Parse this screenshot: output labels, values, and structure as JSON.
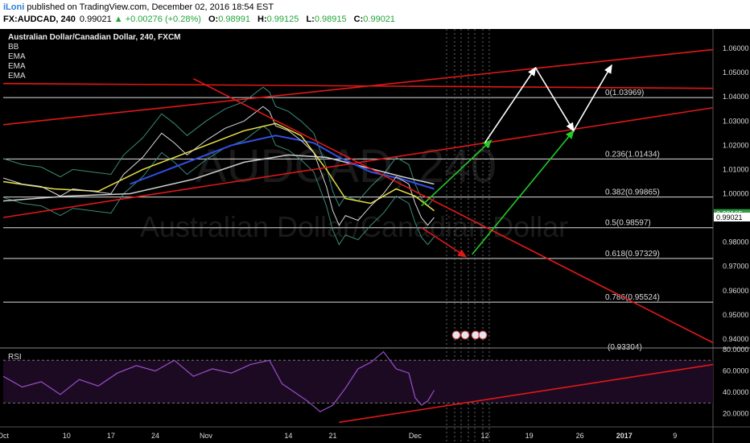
{
  "header": {
    "author": "iLoni",
    "published": "published on TradingView.com, December 02, 2016 18:54 EST",
    "symbol": "FX:AUDCAD, 240",
    "price": "0.99021",
    "change": "+0.00276 (+0.28%)",
    "o_label": "O:",
    "o": "0.98991",
    "h_label": "H:",
    "h": "0.99125",
    "l_label": "L:",
    "l": "0.98915",
    "c_label": "C:",
    "c": "0.99021"
  },
  "indicators": [
    "BB",
    "EMA",
    "EMA",
    "EMA"
  ],
  "colors": {
    "background": "#000000",
    "trendline": "#e01818",
    "fib": "#dddddd",
    "arrow_up": "#22cc22",
    "arrow_white": "#ffffff",
    "ema_yellow": "#e8e040",
    "ema_blue": "#3050e8",
    "ema_white": "#cccccc",
    "rsi_line": "#9a4fc8"
  },
  "chart_data": {
    "type": "line",
    "title": "Australian Dollar/Canadian Dollar, 240, FXCM",
    "watermark_symbol": "AUDCAD, 240",
    "watermark_name": "Australian Dollar/Canadian Dollar",
    "ylim": [
      0.937,
      1.068
    ],
    "yticks": [
      1.06,
      1.05,
      1.04,
      1.03,
      1.02,
      1.01,
      1.0,
      0.99,
      0.98,
      0.97,
      0.96,
      0.95,
      0.94
    ],
    "ytick_labels": [
      "1.06000",
      "1.05000",
      "1.04000",
      "1.03000",
      "1.02000",
      "1.01000",
      "1.00000",
      "0.99000",
      "0.98000",
      "0.97000",
      "0.96000",
      "0.95000",
      "0.94000"
    ],
    "xticks": [
      {
        "t": 0,
        "label": "Oct"
      },
      {
        "t": 10,
        "label": "10"
      },
      {
        "t": 17,
        "label": "17"
      },
      {
        "t": 24,
        "label": "24"
      },
      {
        "t": 32,
        "label": "Nov"
      },
      {
        "t": 45,
        "label": "14"
      },
      {
        "t": 52,
        "label": "21"
      },
      {
        "t": 65,
        "label": "Dec"
      },
      {
        "t": 76,
        "label": "12"
      },
      {
        "t": 83,
        "label": "19"
      },
      {
        "t": 91,
        "label": "26"
      },
      {
        "t": 98,
        "label": "2017"
      },
      {
        "t": 106,
        "label": "9"
      }
    ],
    "price_series": [
      {
        "t": 0,
        "y": 1.0065
      },
      {
        "t": 3,
        "y": 1.004
      },
      {
        "t": 6,
        "y": 1.003
      },
      {
        "t": 9,
        "y": 0.999
      },
      {
        "t": 11,
        "y": 1.002
      },
      {
        "t": 14,
        "y": 1.001
      },
      {
        "t": 17,
        "y": 1.0
      },
      {
        "t": 19,
        "y": 1.008
      },
      {
        "t": 22,
        "y": 1.015
      },
      {
        "t": 25,
        "y": 1.025
      },
      {
        "t": 27,
        "y": 1.021
      },
      {
        "t": 29,
        "y": 1.016
      },
      {
        "t": 32,
        "y": 1.022
      },
      {
        "t": 35,
        "y": 1.027
      },
      {
        "t": 38,
        "y": 1.03
      },
      {
        "t": 41,
        "y": 1.036
      },
      {
        "t": 42,
        "y": 1.034
      },
      {
        "t": 43,
        "y": 1.028
      },
      {
        "t": 45,
        "y": 1.026
      },
      {
        "t": 47,
        "y": 1.022
      },
      {
        "t": 49,
        "y": 1.017
      },
      {
        "t": 51,
        "y": 1.003
      },
      {
        "t": 52,
        "y": 0.993
      },
      {
        "t": 53,
        "y": 0.987
      },
      {
        "t": 54,
        "y": 0.991
      },
      {
        "t": 56,
        "y": 0.989
      },
      {
        "t": 58,
        "y": 0.995
      },
      {
        "t": 60,
        "y": 1.0
      },
      {
        "t": 62,
        "y": 1.007
      },
      {
        "t": 64,
        "y": 1.004
      },
      {
        "t": 65,
        "y": 0.996
      },
      {
        "t": 66,
        "y": 0.99
      },
      {
        "t": 67,
        "y": 0.987
      },
      {
        "t": 68,
        "y": 0.99021
      }
    ],
    "ema_fast": [
      {
        "t": 0,
        "y": 1.005
      },
      {
        "t": 8,
        "y": 1.002
      },
      {
        "t": 15,
        "y": 1.001
      },
      {
        "t": 22,
        "y": 1.01
      },
      {
        "t": 30,
        "y": 1.018
      },
      {
        "t": 38,
        "y": 1.026
      },
      {
        "t": 43,
        "y": 1.029
      },
      {
        "t": 47,
        "y": 1.024
      },
      {
        "t": 51,
        "y": 1.01
      },
      {
        "t": 54,
        "y": 0.998
      },
      {
        "t": 58,
        "y": 0.996
      },
      {
        "t": 62,
        "y": 1.002
      },
      {
        "t": 65,
        "y": 0.999
      },
      {
        "t": 68,
        "y": 0.993
      }
    ],
    "ema_mid": [
      {
        "t": 20,
        "y": 1.004
      },
      {
        "t": 28,
        "y": 1.012
      },
      {
        "t": 36,
        "y": 1.02
      },
      {
        "t": 43,
        "y": 1.024
      },
      {
        "t": 49,
        "y": 1.021
      },
      {
        "t": 53,
        "y": 1.015
      },
      {
        "t": 58,
        "y": 1.009
      },
      {
        "t": 63,
        "y": 1.006
      },
      {
        "t": 68,
        "y": 1.002
      }
    ],
    "ema_slow": [
      {
        "t": 0,
        "y": 0.997
      },
      {
        "t": 10,
        "y": 0.999
      },
      {
        "t": 20,
        "y": 1.0
      },
      {
        "t": 30,
        "y": 1.006
      },
      {
        "t": 38,
        "y": 1.013
      },
      {
        "t": 45,
        "y": 1.016
      },
      {
        "t": 51,
        "y": 1.015
      },
      {
        "t": 57,
        "y": 1.011
      },
      {
        "t": 63,
        "y": 1.007
      },
      {
        "t": 68,
        "y": 1.004
      }
    ],
    "fib_levels": [
      {
        "ratio": "0",
        "value": 1.03969,
        "label": "0(1.03969)"
      },
      {
        "ratio": "0.236",
        "value": 1.01434,
        "label": "0.236(1.01434)"
      },
      {
        "ratio": "0.382",
        "value": 0.99865,
        "label": "0.382(0.99865)"
      },
      {
        "ratio": "0.5",
        "value": 0.98597,
        "label": "0.5(0.98597)"
      },
      {
        "ratio": "0.618",
        "value": 0.97329,
        "label": "0.618(0.97329)"
      },
      {
        "ratio": "0.786",
        "value": 0.95524,
        "label": "0.786(0.95524)"
      }
    ],
    "fib_extra_label": "(0.93304)",
    "trendlines": [
      {
        "from": {
          "t": 0,
          "y": 1.0285
        },
        "to": {
          "t": 112,
          "y": 1.0595
        }
      },
      {
        "from": {
          "t": 0,
          "y": 0.9902
        },
        "to": {
          "t": 112,
          "y": 1.0355
        }
      },
      {
        "from": {
          "t": 0,
          "y": 1.0455
        },
        "to": {
          "t": 112,
          "y": 1.0435
        }
      },
      {
        "from": {
          "t": 30,
          "y": 1.0475
        },
        "to": {
          "t": 112,
          "y": 0.9385
        }
      }
    ],
    "projection_arrows": [
      {
        "color": "green",
        "from": {
          "t": 66,
          "y": 0.995
        },
        "to": {
          "t": 77,
          "y": 1.022
        }
      },
      {
        "color": "red",
        "from": {
          "t": 66,
          "y": 0.986
        },
        "to": {
          "t": 73,
          "y": 0.974
        }
      },
      {
        "color": "green",
        "from": {
          "t": 74,
          "y": 0.975
        },
        "to": {
          "t": 90,
          "y": 1.026
        }
      },
      {
        "color": "white",
        "from": {
          "t": 76,
          "y": 1.021
        },
        "to": {
          "t": 84,
          "y": 1.052
        }
      },
      {
        "color": "white",
        "from": {
          "t": 84,
          "y": 1.052
        },
        "to": {
          "t": 90,
          "y": 1.026
        }
      },
      {
        "color": "white",
        "from": {
          "t": 90,
          "y": 1.026
        },
        "to": {
          "t": 96,
          "y": 1.053
        }
      }
    ],
    "price_labels": [
      {
        "value": "0.99165",
        "y": 0.99165,
        "bg": "#2a9a43"
      },
      {
        "value": "0.99021",
        "y": 0.99021,
        "bg": "#ffffff"
      }
    ],
    "rsi": {
      "label": "RSI",
      "ylim": [
        10,
        80
      ],
      "yticks": [
        80,
        60,
        40,
        20
      ],
      "ytick_labels": [
        "80.0000",
        "60.0000",
        "40.0000",
        "20.0000"
      ],
      "bands": [
        70,
        30
      ],
      "series": [
        {
          "t": 0,
          "y": 55
        },
        {
          "t": 3,
          "y": 45
        },
        {
          "t": 6,
          "y": 50
        },
        {
          "t": 9,
          "y": 38
        },
        {
          "t": 12,
          "y": 52
        },
        {
          "t": 15,
          "y": 46
        },
        {
          "t": 18,
          "y": 58
        },
        {
          "t": 21,
          "y": 65
        },
        {
          "t": 24,
          "y": 60
        },
        {
          "t": 27,
          "y": 70
        },
        {
          "t": 30,
          "y": 55
        },
        {
          "t": 33,
          "y": 62
        },
        {
          "t": 36,
          "y": 58
        },
        {
          "t": 39,
          "y": 66
        },
        {
          "t": 42,
          "y": 70
        },
        {
          "t": 44,
          "y": 48
        },
        {
          "t": 46,
          "y": 40
        },
        {
          "t": 48,
          "y": 32
        },
        {
          "t": 50,
          "y": 22
        },
        {
          "t": 52,
          "y": 28
        },
        {
          "t": 54,
          "y": 44
        },
        {
          "t": 56,
          "y": 62
        },
        {
          "t": 58,
          "y": 68
        },
        {
          "t": 60,
          "y": 78
        },
        {
          "t": 62,
          "y": 62
        },
        {
          "t": 64,
          "y": 58
        },
        {
          "t": 65,
          "y": 35
        },
        {
          "t": 66,
          "y": 28
        },
        {
          "t": 67,
          "y": 32
        },
        {
          "t": 68,
          "y": 42
        }
      ],
      "trendline": {
        "from": {
          "t": 53,
          "y": 12
        },
        "to": {
          "t": 112,
          "y": 66
        }
      }
    },
    "xlim": [
      0,
      112
    ]
  }
}
